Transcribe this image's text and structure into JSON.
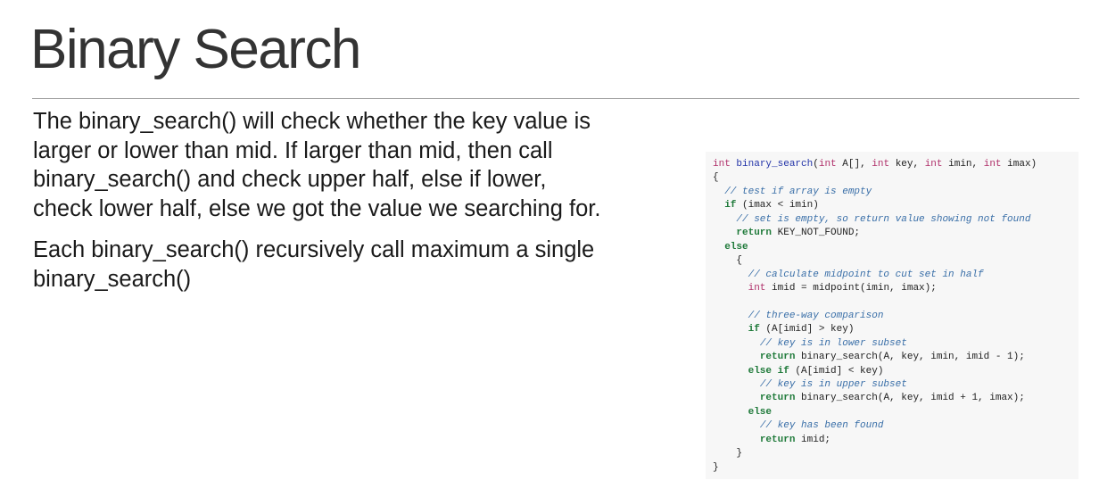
{
  "slide": {
    "title": "Binary Search",
    "paragraphs": [
      "The binary_search() will check whether the key value is larger or lower than mid. If larger than mid, then call binary_search() and check upper half, else if lower, check lower half, else we got the value we searching for.",
      "Each binary_search() recursively call maximum a single binary_search()"
    ]
  },
  "code": {
    "lines": [
      "int binary_search(int A[], int key, int imin, int imax)",
      "{",
      "  // test if array is empty",
      "  if (imax < imin)",
      "    // set is empty, so return value showing not found",
      "    return KEY_NOT_FOUND;",
      "  else",
      "    {",
      "      // calculate midpoint to cut set in half",
      "      int imid = midpoint(imin, imax);",
      "",
      "      // three-way comparison",
      "      if (A[imid] > key)",
      "        // key is in lower subset",
      "        return binary_search(A, key, imin, imid - 1);",
      "      else if (A[imid] < key)",
      "        // key is in upper subset",
      "        return binary_search(A, key, imid + 1, imax);",
      "      else",
      "        // key has been found",
      "        return imid;",
      "    }",
      "}"
    ]
  },
  "colors": {
    "type_keyword": "#b0306a",
    "function_name": "#2233a8",
    "control_keyword": "#1f7a3a",
    "comment": "#3a6fa8",
    "code_background": "#f7f7f7"
  }
}
